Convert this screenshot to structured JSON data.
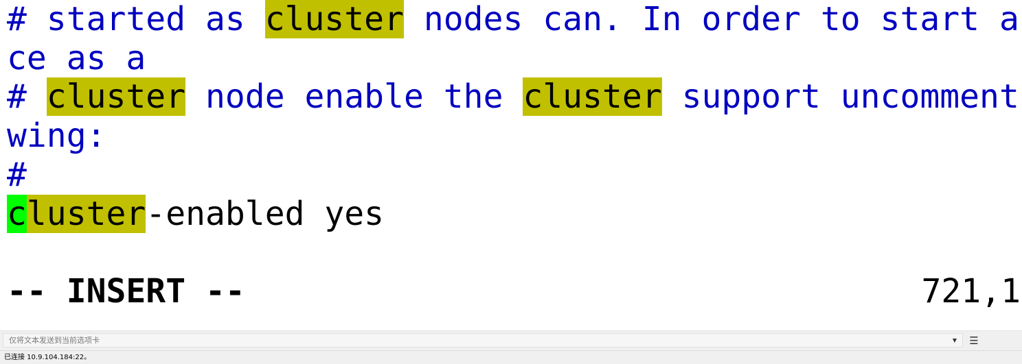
{
  "terminal": {
    "lines": [
      [
        {
          "text": "# started as ",
          "style": "comment"
        },
        {
          "text": "cluster",
          "style": "match"
        },
        {
          "text": " nodes can. In order to start a",
          "style": "comment"
        }
      ],
      [
        {
          "text": "ce as a",
          "style": "comment"
        }
      ],
      [
        {
          "text": "# ",
          "style": "comment"
        },
        {
          "text": "cluster",
          "style": "match"
        },
        {
          "text": " node enable the ",
          "style": "comment"
        },
        {
          "text": "cluster",
          "style": "match"
        },
        {
          "text": " support uncomment",
          "style": "comment"
        }
      ],
      [
        {
          "text": "wing:",
          "style": "comment"
        }
      ],
      [
        {
          "text": "#",
          "style": "comment"
        }
      ],
      [
        {
          "text": "c",
          "style": "cursor"
        },
        {
          "text": "luster",
          "style": "match"
        },
        {
          "text": "-enabled yes",
          "style": "plain"
        }
      ]
    ],
    "status_mode": "-- INSERT --",
    "status_position": "721,1"
  },
  "send_bar": {
    "placeholder": "仅将文本发送到当前选项卡",
    "dropdown_icon": "chevron-down-icon",
    "menu_icon": "hamburger-menu-icon"
  },
  "statusbar": {
    "connection_text": "已连接 10.9.104.184:22。"
  },
  "colors": {
    "comment": "#0000c0",
    "match_highlight": "#c0c000",
    "cursor": "#00ff00",
    "text": "#000000",
    "background": "#ffffff"
  }
}
